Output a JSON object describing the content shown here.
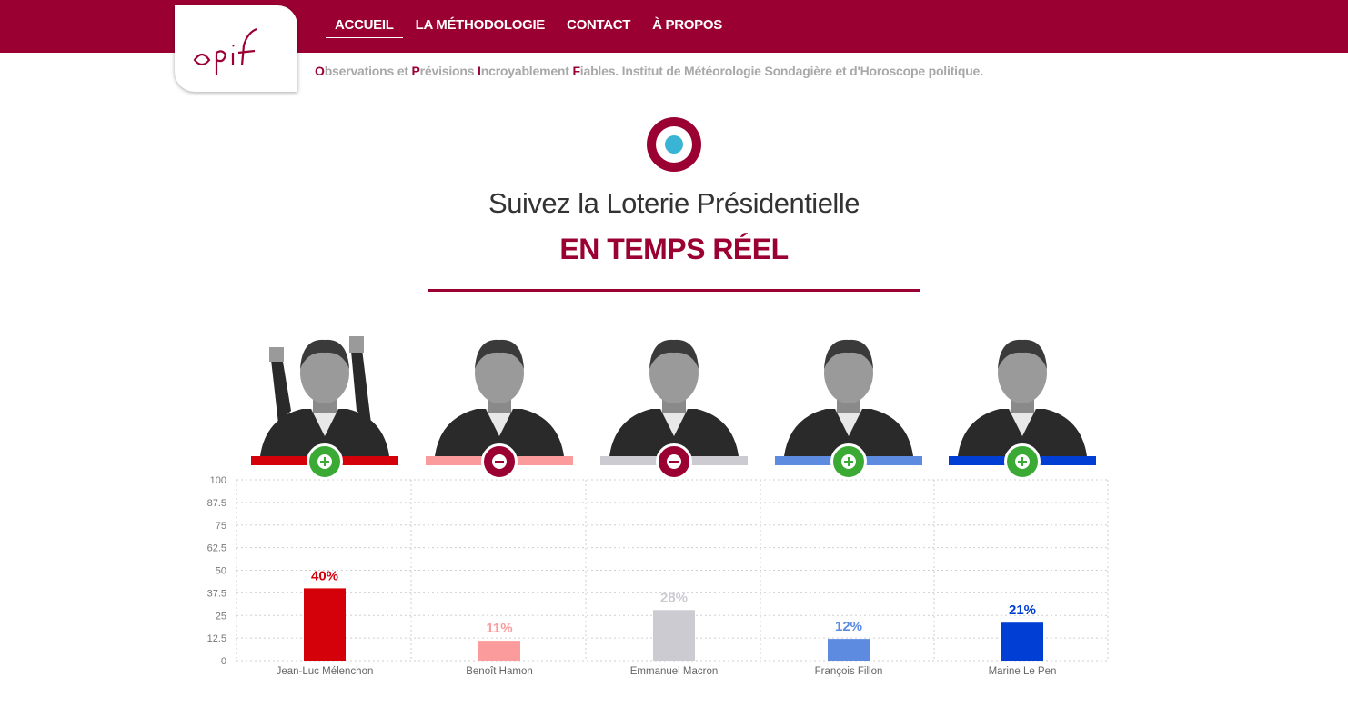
{
  "header": {
    "logo_text": "opif",
    "nav": [
      {
        "label": "ACCUEIL",
        "active": true
      },
      {
        "label": "LA MÉTHODOLOGIE",
        "active": false
      },
      {
        "label": "CONTACT",
        "active": false
      },
      {
        "label": "À PROPOS",
        "active": false
      }
    ],
    "tagline": [
      {
        "init": "O",
        "rest": "bservations et "
      },
      {
        "init": "P",
        "rest": "révisions "
      },
      {
        "init": "I",
        "rest": "ncroyablement "
      },
      {
        "init": "F",
        "rest": "iables. Institut de Météorologie Sondagière et d'Horoscope politique."
      }
    ]
  },
  "hero": {
    "title": "Suivez la Loterie Présidentielle",
    "subtitle": "EN TEMPS RÉEL"
  },
  "colors": {
    "brand": "#9b0032",
    "plus_button": "#3aaa35",
    "target_center": "#3ab4d4"
  },
  "candidates": [
    {
      "name": "Jean-Luc Mélenchon",
      "vote_button": "plus",
      "color": "#d4000a",
      "portrait_icon": "candidate-portrait-icon"
    },
    {
      "name": "Benoît Hamon",
      "vote_button": "minus",
      "color": "#fc9b9b",
      "portrait_icon": "candidate-portrait-icon"
    },
    {
      "name": "Emmanuel Macron",
      "vote_button": "minus",
      "color": "#cccbd2",
      "portrait_icon": "candidate-portrait-icon"
    },
    {
      "name": "François Fillon",
      "vote_button": "plus",
      "color": "#5c8be0",
      "portrait_icon": "candidate-portrait-icon"
    },
    {
      "name": "Marine Le Pen",
      "vote_button": "plus",
      "color": "#003ed4",
      "portrait_icon": "candidate-portrait-icon"
    }
  ],
  "chart_data": {
    "type": "bar",
    "categories": [
      "Jean-Luc Mélenchon",
      "Benoît Hamon",
      "Emmanuel Macron",
      "François Fillon",
      "Marine Le Pen"
    ],
    "values": [
      40,
      11,
      28,
      12,
      21
    ],
    "value_labels": [
      "40%",
      "11%",
      "28%",
      "12%",
      "21%"
    ],
    "colors": [
      "#d4000a",
      "#fc9b9b",
      "#cccbd2",
      "#5c8be0",
      "#003ed4"
    ],
    "yticks": [
      "0",
      "12.5",
      "25",
      "37.5",
      "50",
      "62.5",
      "75",
      "87.5",
      "100"
    ],
    "ylim": [
      0,
      100
    ],
    "grid": true,
    "title": "",
    "xlabel": "",
    "ylabel": ""
  }
}
